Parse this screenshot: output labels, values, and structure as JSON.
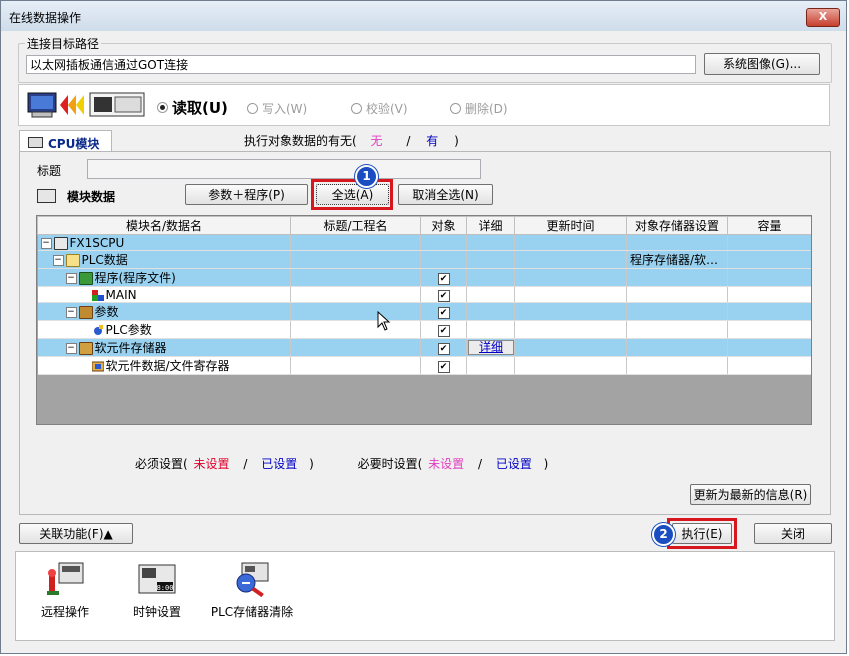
{
  "window": {
    "title": "在线数据操作",
    "close_label": "X"
  },
  "connection": {
    "legend": "连接目标路径",
    "path_value": "以太网插板通信通过GOT连接",
    "system_image_button": "系统图像(G)..."
  },
  "operation": {
    "read_label": "读取(U)",
    "write_label": "写入(W)",
    "verify_label": "校验(V)",
    "delete_label": "删除(D)"
  },
  "tab": {
    "label": "CPU模块",
    "exists_prefix": "执行对象数据的有无(",
    "exists_none": "无",
    "exists_sep": "/",
    "exists_yes": "有",
    "exists_suffix": ")"
  },
  "module": {
    "title_label": "标题",
    "title_value": "",
    "module_data_label": "模块数据",
    "param_program_button": "参数＋程序(P)",
    "select_all_button": "全选(A)",
    "deselect_all_button": "取消全选(N)"
  },
  "table": {
    "headers": [
      "模块名/数据名",
      "标题/工程名",
      "对象",
      "详细",
      "更新时间",
      "对象存储器设置",
      "容量"
    ],
    "rows": [
      {
        "name": "FX1SCPU",
        "memory": "",
        "checked": false,
        "detail": ""
      },
      {
        "name": "PLC数据",
        "memory": "程序存储器/软…",
        "checked": false,
        "detail": ""
      },
      {
        "name": "程序(程序文件)",
        "memory": "",
        "checked": true,
        "detail": ""
      },
      {
        "name": "MAIN",
        "memory": "",
        "checked": true,
        "detail": ""
      },
      {
        "name": "参数",
        "memory": "",
        "checked": true,
        "detail": ""
      },
      {
        "name": "PLC参数",
        "memory": "",
        "checked": true,
        "detail": ""
      },
      {
        "name": "软元件存储器",
        "memory": "",
        "checked": true,
        "detail": "详细"
      },
      {
        "name": "软元件数据/文件寄存器",
        "memory": "",
        "checked": true,
        "detail": ""
      }
    ]
  },
  "legend_row": {
    "required_prefix": "必须设置(",
    "required_unset": "未设置",
    "required_set": "已设置",
    "optional_prefix": "必要时设置(",
    "optional_unset": "未设置",
    "optional_set": "已设置",
    "sep": "/",
    "suffix": ")"
  },
  "buttons": {
    "update_info": "更新为最新的信息(R)",
    "related_functions": "关联功能(F)▲",
    "execute": "执行(E)",
    "close": "关闭"
  },
  "markers": {
    "badge1": "1",
    "badge2": "2"
  },
  "tools": [
    {
      "label": "远程操作",
      "icon": "remote-operation-icon"
    },
    {
      "label": "时钟设置",
      "icon": "clock-setting-icon",
      "display": "8:00"
    },
    {
      "label": "PLC存储器清除",
      "icon": "plc-memory-clear-icon"
    }
  ],
  "colors": {
    "highlight": "#d6181e",
    "badge": "#1a4ec0",
    "selected_row": "#99d2f1",
    "unset": "#e0002a",
    "set": "#0000c8",
    "optional_unset": "#e040c0"
  }
}
